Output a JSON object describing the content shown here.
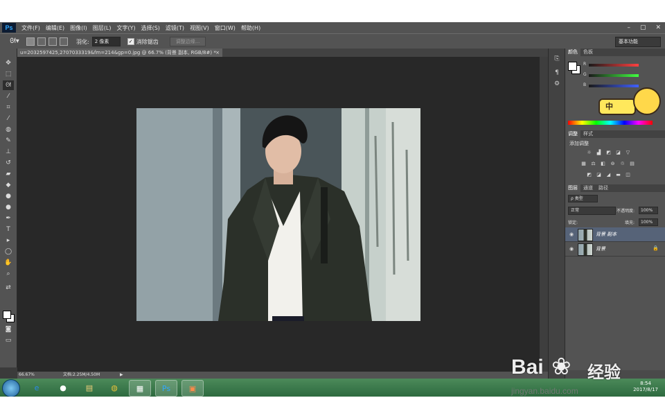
{
  "menubar": {
    "logo": "Ps",
    "items": [
      "文件(F)",
      "编辑(E)",
      "图像(I)",
      "图层(L)",
      "文字(Y)",
      "选择(S)",
      "滤镜(T)",
      "视图(V)",
      "窗口(W)",
      "帮助(H)"
    ],
    "window_controls": [
      "–",
      "▢",
      "✕"
    ]
  },
  "options_bar": {
    "feather_label": "羽化:",
    "feather_value": "2 像素",
    "antialias_label": "消除锯齿",
    "antialias_checked": true,
    "refine_edge_label": "调整边缘...",
    "workspace": "基本功能"
  },
  "document": {
    "tab_title": "u=2032597425,2707033319&fm=214&gp=0.jpg @ 66.7% (背景 副本, RGB/8#) *",
    "tab_close": "×"
  },
  "status": {
    "zoom": "66.67%",
    "doc_size": "文档:2.25M/4.50M",
    "arrow": "▶"
  },
  "color_panel": {
    "tabs": [
      "颜色",
      "色板"
    ],
    "channels": [
      "R",
      "G",
      "B"
    ],
    "colors": {
      "r": "#e84040",
      "g": "#38c838",
      "b": "#3a6ae8"
    }
  },
  "adjustments_panel": {
    "tabs": [
      "调整",
      "样式"
    ],
    "title": "添加调整"
  },
  "layers_panel": {
    "tabs": [
      "图层",
      "通道",
      "路径"
    ],
    "kind_filter": "ρ 类型",
    "blend_mode": "正常",
    "opacity_label": "不透明度:",
    "opacity_value": "100%",
    "lock_label": "锁定:",
    "fill_label": "填充:",
    "fill_value": "100%",
    "layers": [
      {
        "name": "背景 副本",
        "selected": true,
        "locked": false
      },
      {
        "name": "背景",
        "selected": false,
        "locked": true
      }
    ]
  },
  "sticker": {
    "text": "中"
  },
  "taskbar": {
    "apps": [
      "ie-icon",
      "xiuxiu-icon",
      "explorer-icon",
      "chrome-icon",
      "notepad-icon",
      "photoshop-icon",
      "slides-icon"
    ],
    "tray_lang": "CH",
    "time": "8:54",
    "date": "2017/8/17"
  },
  "watermark": {
    "brand": "Bai",
    "brand_cn": "经验",
    "url": "jingyan.baidu.com"
  }
}
